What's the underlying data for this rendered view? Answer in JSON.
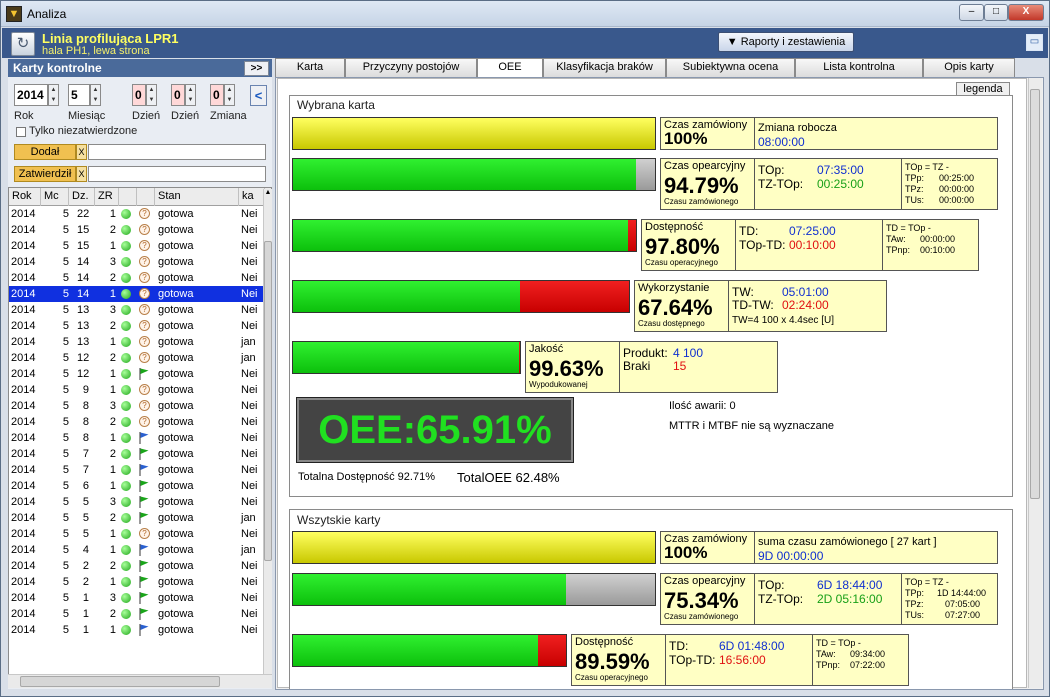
{
  "window": {
    "title": "Analiza",
    "minimize": "–",
    "maximize": "□",
    "close": "X"
  },
  "header": {
    "title": "Linia profilująca LPR1",
    "subtitle": "hala PH1, lewa strona",
    "reports_button": "Raporty i zestawienia",
    "reports_arrow": "▼"
  },
  "left": {
    "panel_title": "Karty kontrolne",
    "expand_button": ">>",
    "year": "2014",
    "month": "5",
    "day1": "0",
    "day2": "0",
    "shift": "0",
    "labels": {
      "year": "Rok",
      "month": "Miesiąc",
      "day1": "Dzień",
      "day2": "Dzień",
      "shift": "Zmiana"
    },
    "nav_button": "<",
    "only_unapproved": "Tylko niezatwierdzone",
    "added_by": "Dodał",
    "approved_by": "Zatwierdził",
    "clear": "X",
    "columns": [
      "Rok",
      "Mc",
      "Dz.",
      "ZR",
      "",
      "",
      "Stan",
      "ka"
    ],
    "rows": [
      {
        "rok": "2014",
        "mc": "5",
        "dz": "22",
        "zr": "1",
        "flag": "q",
        "stan": "gotowa",
        "ka": "Nei"
      },
      {
        "rok": "2014",
        "mc": "5",
        "dz": "15",
        "zr": "2",
        "flag": "q",
        "stan": "gotowa",
        "ka": "Nei"
      },
      {
        "rok": "2014",
        "mc": "5",
        "dz": "15",
        "zr": "1",
        "flag": "q",
        "stan": "gotowa",
        "ka": "Nei"
      },
      {
        "rok": "2014",
        "mc": "5",
        "dz": "14",
        "zr": "3",
        "flag": "q",
        "stan": "gotowa",
        "ka": "Nei"
      },
      {
        "rok": "2014",
        "mc": "5",
        "dz": "14",
        "zr": "2",
        "flag": "q",
        "stan": "gotowa",
        "ka": "Nei"
      },
      {
        "rok": "2014",
        "mc": "5",
        "dz": "14",
        "zr": "1",
        "flag": "q",
        "stan": "gotowa",
        "ka": "Nei",
        "selected": true
      },
      {
        "rok": "2014",
        "mc": "5",
        "dz": "13",
        "zr": "3",
        "flag": "q",
        "stan": "gotowa",
        "ka": "Nei"
      },
      {
        "rok": "2014",
        "mc": "5",
        "dz": "13",
        "zr": "2",
        "flag": "q",
        "stan": "gotowa",
        "ka": "Nei"
      },
      {
        "rok": "2014",
        "mc": "5",
        "dz": "13",
        "zr": "1",
        "flag": "q",
        "stan": "gotowa",
        "ka": "jan"
      },
      {
        "rok": "2014",
        "mc": "5",
        "dz": "12",
        "zr": "2",
        "flag": "q",
        "stan": "gotowa",
        "ka": "jan"
      },
      {
        "rok": "2014",
        "mc": "5",
        "dz": "12",
        "zr": "1",
        "flag": "g",
        "stan": "gotowa",
        "ka": "Nei"
      },
      {
        "rok": "2014",
        "mc": "5",
        "dz": "9",
        "zr": "1",
        "flag": "q",
        "stan": "gotowa",
        "ka": "Nei"
      },
      {
        "rok": "2014",
        "mc": "5",
        "dz": "8",
        "zr": "3",
        "flag": "q",
        "stan": "gotowa",
        "ka": "Nei"
      },
      {
        "rok": "2014",
        "mc": "5",
        "dz": "8",
        "zr": "2",
        "flag": "q",
        "stan": "gotowa",
        "ka": "Nei"
      },
      {
        "rok": "2014",
        "mc": "5",
        "dz": "8",
        "zr": "1",
        "flag": "b",
        "stan": "gotowa",
        "ka": "Nei"
      },
      {
        "rok": "2014",
        "mc": "5",
        "dz": "7",
        "zr": "2",
        "flag": "g",
        "stan": "gotowa",
        "ka": "Nei"
      },
      {
        "rok": "2014",
        "mc": "5",
        "dz": "7",
        "zr": "1",
        "flag": "b",
        "stan": "gotowa",
        "ka": "Nei"
      },
      {
        "rok": "2014",
        "mc": "5",
        "dz": "6",
        "zr": "1",
        "flag": "g",
        "stan": "gotowa",
        "ka": "Nei"
      },
      {
        "rok": "2014",
        "mc": "5",
        "dz": "5",
        "zr": "3",
        "flag": "g",
        "stan": "gotowa",
        "ka": "Nei"
      },
      {
        "rok": "2014",
        "mc": "5",
        "dz": "5",
        "zr": "2",
        "flag": "g",
        "stan": "gotowa",
        "ka": "jan"
      },
      {
        "rok": "2014",
        "mc": "5",
        "dz": "5",
        "zr": "1",
        "flag": "q",
        "stan": "gotowa",
        "ka": "Nei"
      },
      {
        "rok": "2014",
        "mc": "5",
        "dz": "4",
        "zr": "1",
        "flag": "b",
        "stan": "gotowa",
        "ka": "jan"
      },
      {
        "rok": "2014",
        "mc": "5",
        "dz": "2",
        "zr": "2",
        "flag": "g",
        "stan": "gotowa",
        "ka": "Nei"
      },
      {
        "rok": "2014",
        "mc": "5",
        "dz": "2",
        "zr": "1",
        "flag": "g",
        "stan": "gotowa",
        "ka": "Nei"
      },
      {
        "rok": "2014",
        "mc": "5",
        "dz": "1",
        "zr": "3",
        "flag": "g",
        "stan": "gotowa",
        "ka": "Nei"
      },
      {
        "rok": "2014",
        "mc": "5",
        "dz": "1",
        "zr": "2",
        "flag": "g",
        "stan": "gotowa",
        "ka": "Nei"
      },
      {
        "rok": "2014",
        "mc": "5",
        "dz": "1",
        "zr": "1",
        "flag": "b",
        "stan": "gotowa",
        "ka": "Nei"
      }
    ]
  },
  "tabs": [
    "Karta",
    "Przyczyny postojów",
    "OEE",
    "Klasyfikacja braków",
    "Subiektywna ocena",
    "Lista kontrolna",
    "Opis karty"
  ],
  "active_tab": "OEE",
  "legend_button": "legenda",
  "selected": {
    "title": "Wybrana karta",
    "ordered": {
      "title": "Czas zamówiony",
      "pct": "100%",
      "label": "Zmiana robocza",
      "value": "08:00:00",
      "fill": 100
    },
    "operating": {
      "title": "Czas opearcyjny",
      "pct": "94.79%",
      "sub": "Czasu zamówionego",
      "l1": "TOp:",
      "v1": "07:35:00",
      "l2": "TZ-TOp:",
      "v2": "00:25:00",
      "formula": "TOp = TZ -",
      "r": [
        [
          "TPp:",
          "00:25:00"
        ],
        [
          "TPz:",
          "00:00:00"
        ],
        [
          "TUs:",
          "00:00:00"
        ]
      ],
      "fill": 94.79
    },
    "availability": {
      "title": "Dostępność",
      "pct": "97.80%",
      "sub": "Czasu operacyjnego",
      "l1": "TD:",
      "v1": "07:25:00",
      "l2": "TOp-TD:",
      "v2": "00:10:00",
      "formula": "TD = TOp -",
      "r": [
        [
          "TAw:",
          "00:00:00"
        ],
        [
          "TPnp:",
          "00:10:00"
        ]
      ],
      "fill": 97.8
    },
    "utilization": {
      "title": "Wykorzystanie",
      "pct": "67.64%",
      "sub": "Czasu dostępnego",
      "l1": "TW:",
      "v1": "05:01:00",
      "l2": "TD-TW:",
      "v2": "02:24:00",
      "note": "TW=4 100 x 4.4sec [U]",
      "fill": 67.64
    },
    "quality": {
      "title": "Jakość",
      "pct": "99.63%",
      "sub": "Wypodukowanej",
      "l1": "Produkt:",
      "v1": "4 100",
      "l2": "Braki",
      "v2": "15",
      "fill": 99.63
    },
    "oee": "OEE:65.91%",
    "failures": "Ilość awarii: 0",
    "mttr": "MTTR i MTBF nie są wyznaczane",
    "total_avail": "Totalna Dostępność 92.71%",
    "total_oee": "TotalOEE 62.48%"
  },
  "all": {
    "title": "Wszytskie karty",
    "ordered": {
      "title": "Czas zamówiony",
      "pct": "100%",
      "label": "suma czasu zamówionego  [ 27 kart ]",
      "value": "9D 00:00:00",
      "fill": 100
    },
    "operating": {
      "title": "Czas opearcyjny",
      "pct": "75.34%",
      "sub": "Czasu zamówionego",
      "l1": "TOp:",
      "v1": "6D 18:44:00",
      "l2": "TZ-TOp:",
      "v2": "2D 05:16:00",
      "formula": "TOp = TZ -",
      "r": [
        [
          "TPp:",
          "1D 14:44:00"
        ],
        [
          "TPz:",
          "07:05:00"
        ],
        [
          "TUs:",
          "07:27:00"
        ]
      ],
      "fill": 75.34
    },
    "availability": {
      "title": "Dostępność",
      "pct": "89.59%",
      "sub": "Czasu operacyjnego",
      "l1": "TD:",
      "v1": "6D 01:48:00",
      "l2": "TOp-TD:",
      "v2": "16:56:00",
      "formula": "TD = TOp -",
      "r": [
        [
          "TAw:",
          "09:34:00"
        ],
        [
          "TPnp:",
          "07:22:00"
        ]
      ],
      "fill": 89.59
    }
  },
  "colors": {
    "yellow": "#e0e000",
    "green": "#10d010",
    "red": "#e00000",
    "grey": "#b0b0b0",
    "oee_text": "#20e020",
    "selected_row": "#1030e0",
    "header_bg": "#39588c"
  }
}
